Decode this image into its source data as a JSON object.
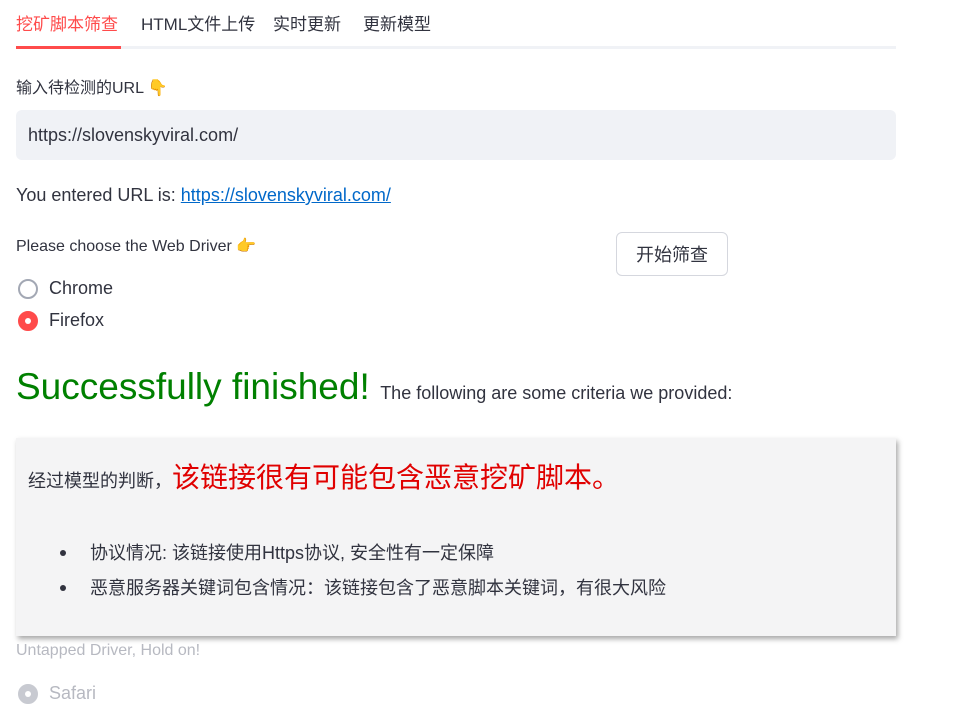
{
  "tabs": [
    {
      "label": "挖矿脚本筛查",
      "active": true
    },
    {
      "label": "HTML文件上传",
      "active": false
    },
    {
      "label": "实时更新",
      "active": false
    },
    {
      "label": "更新模型",
      "active": false
    }
  ],
  "url_section": {
    "label": "输入待检测的URL 👇",
    "value": "https://slovenskyviral.com/"
  },
  "entered": {
    "prefix": "You entered URL is:",
    "link": "https://slovenskyviral.com/"
  },
  "driver": {
    "label": "Please choose the Web Driver 👉",
    "options": [
      {
        "label": "Chrome",
        "checked": false
      },
      {
        "label": "Firefox",
        "checked": true
      }
    ],
    "start_button": "开始筛查"
  },
  "result": {
    "title": "Successfully finished!",
    "subtitle": "The following are some criteria we provided:",
    "judge_prefix": "经过模型的判断，",
    "judge_result": "该链接很有可能包含恶意挖矿脚本。",
    "criteria": [
      "协议情况: 该链接使用Https协议, 安全性有一定保障",
      "恶意服务器关键词包含情况：该链接包含了恶意脚本关键词，有很大风险"
    ]
  },
  "untapped": {
    "label": "Untapped Driver, Hold on!",
    "option": "Safari"
  },
  "colors": {
    "accent": "#ff4b4b",
    "success": "#008000",
    "danger": "#e00000",
    "link": "#0068c9"
  }
}
